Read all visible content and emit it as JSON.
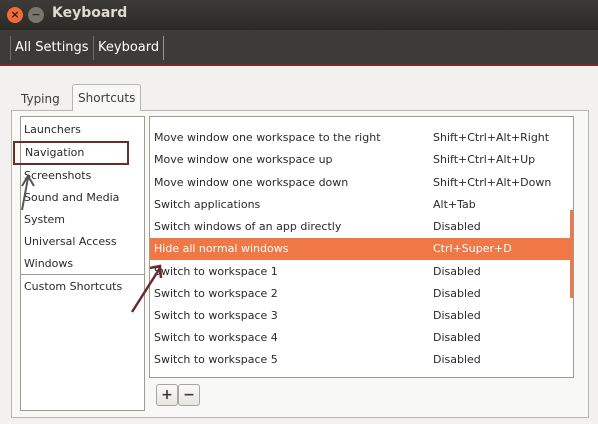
{
  "window": {
    "title": "Keyboard",
    "close_glyph": "×",
    "min_glyph": "−"
  },
  "breadcrumb": {
    "items": [
      "All Settings",
      "Keyboard"
    ]
  },
  "tabs": [
    {
      "label": "Typing",
      "active": false
    },
    {
      "label": "Shortcuts",
      "active": true
    }
  ],
  "categories": {
    "items": [
      {
        "label": "Launchers",
        "selected": false
      },
      {
        "label": "Navigation",
        "selected": true
      },
      {
        "label": "Screenshots",
        "selected": false
      },
      {
        "label": "Sound and Media",
        "selected": false
      },
      {
        "label": "System",
        "selected": false
      },
      {
        "label": "Universal Access",
        "selected": false
      },
      {
        "label": "Windows",
        "selected": false
      }
    ],
    "custom": "Custom Shortcuts"
  },
  "shortcuts": {
    "rows": [
      {
        "action": "Move window one workspace to the right",
        "accel": "Shift+Ctrl+Alt+Right",
        "selected": false
      },
      {
        "action": "Move window one workspace up",
        "accel": "Shift+Ctrl+Alt+Up",
        "selected": false
      },
      {
        "action": "Move window one workspace down",
        "accel": "Shift+Ctrl+Alt+Down",
        "selected": false
      },
      {
        "action": "Switch applications",
        "accel": "Alt+Tab",
        "selected": false
      },
      {
        "action": "Switch windows of an app directly",
        "accel": "Disabled",
        "selected": false
      },
      {
        "action": "Hide all normal windows",
        "accel": "Ctrl+Super+D",
        "selected": true
      },
      {
        "action": "Switch to workspace 1",
        "accel": "Disabled",
        "selected": false
      },
      {
        "action": "Switch to workspace 2",
        "accel": "Disabled",
        "selected": false
      },
      {
        "action": "Switch to workspace 3",
        "accel": "Disabled",
        "selected": false
      },
      {
        "action": "Switch to workspace 4",
        "accel": "Disabled",
        "selected": false
      },
      {
        "action": "Switch to workspace 5",
        "accel": "Disabled",
        "selected": false
      }
    ]
  },
  "buttons": {
    "add": "+",
    "remove": "−"
  },
  "colors": {
    "accent": "#f07746",
    "annotation": "#6b2c2c"
  }
}
